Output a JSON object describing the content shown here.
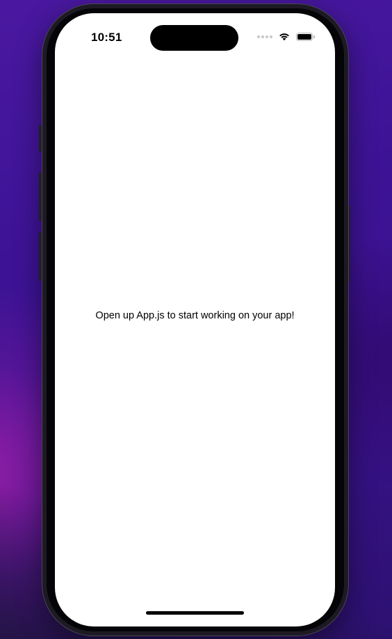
{
  "status_bar": {
    "time": "10:51",
    "signal_icon": "signal-dots-icon",
    "wifi_icon": "wifi-icon",
    "battery_icon": "battery-icon",
    "battery_level": 1.0
  },
  "app": {
    "message": "Open up App.js to start working on your app!"
  },
  "colors": {
    "wallpaper": "#3d1395",
    "wallpaper_accent": "#a520aa",
    "screen_background": "#ffffff",
    "text": "#000000"
  }
}
